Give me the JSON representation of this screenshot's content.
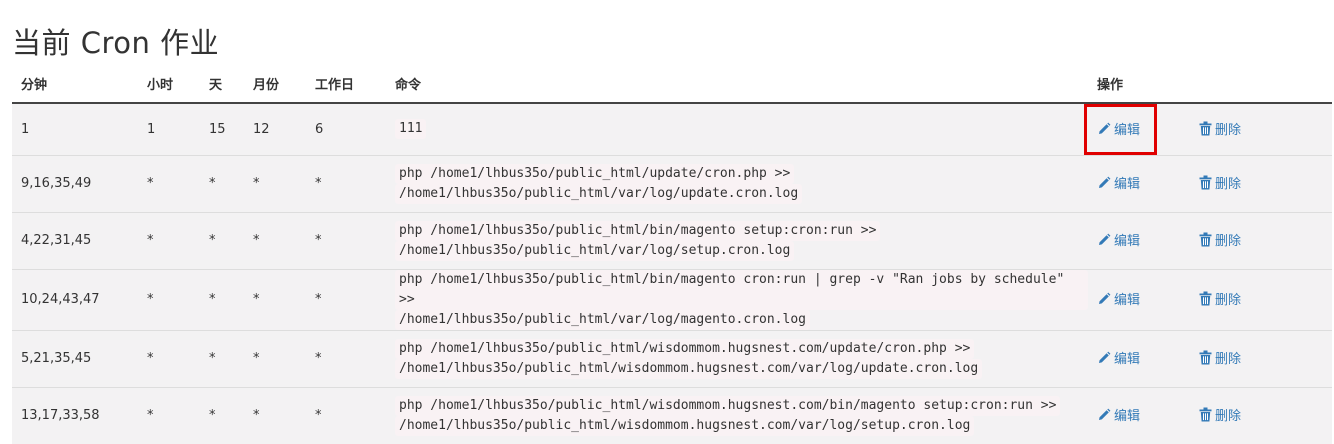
{
  "page": {
    "title": "当前 Cron 作业"
  },
  "table": {
    "headers": {
      "minute": "分钟",
      "hour": "小时",
      "day": "天",
      "month": "月份",
      "weekday": "工作日",
      "command": "命令",
      "actions": "操作"
    },
    "edit_label": "编辑",
    "delete_label": "删除",
    "rows": [
      {
        "minute": "1",
        "hour": "1",
        "day": "15",
        "month": "12",
        "weekday": "6",
        "command_line1": "111",
        "command_line2": ""
      },
      {
        "minute": "9,16,35,49",
        "hour": "*",
        "day": "*",
        "month": "*",
        "weekday": "*",
        "command_line1": "php /home1/lhbus35o/public_html/update/cron.php >>",
        "command_line2": "/home1/lhbus35o/public_html/var/log/update.cron.log"
      },
      {
        "minute": "4,22,31,45",
        "hour": "*",
        "day": "*",
        "month": "*",
        "weekday": "*",
        "command_line1": "php /home1/lhbus35o/public_html/bin/magento setup:cron:run >>",
        "command_line2": "/home1/lhbus35o/public_html/var/log/setup.cron.log"
      },
      {
        "minute": "10,24,43,47",
        "hour": "*",
        "day": "*",
        "month": "*",
        "weekday": "*",
        "command_line1": "php /home1/lhbus35o/public_html/bin/magento cron:run | grep -v \"Ran jobs by schedule\" >>",
        "command_line2": "/home1/lhbus35o/public_html/var/log/magento.cron.log"
      },
      {
        "minute": "5,21,35,45",
        "hour": "*",
        "day": "*",
        "month": "*",
        "weekday": "*",
        "command_line1": "php /home1/lhbus35o/public_html/wisdommom.hugsnest.com/update/cron.php >>",
        "command_line2": "/home1/lhbus35o/public_html/wisdommom.hugsnest.com/var/log/update.cron.log"
      },
      {
        "minute": "13,17,33,58",
        "hour": "*",
        "day": "*",
        "month": "*",
        "weekday": "*",
        "command_line1": "php /home1/lhbus35o/public_html/wisdommom.hugsnest.com/bin/magento setup:cron:run >>",
        "command_line2": "/home1/lhbus35o/public_html/wisdommom.hugsnest.com/var/log/setup.cron.log"
      }
    ]
  },
  "icons": {
    "edit": "pencil-icon",
    "delete": "trash-icon"
  },
  "colors": {
    "link": "#337ab7",
    "command_text": "#c7254e",
    "highlight_border": "#e00000",
    "row_bg": "#f3f2f3"
  }
}
